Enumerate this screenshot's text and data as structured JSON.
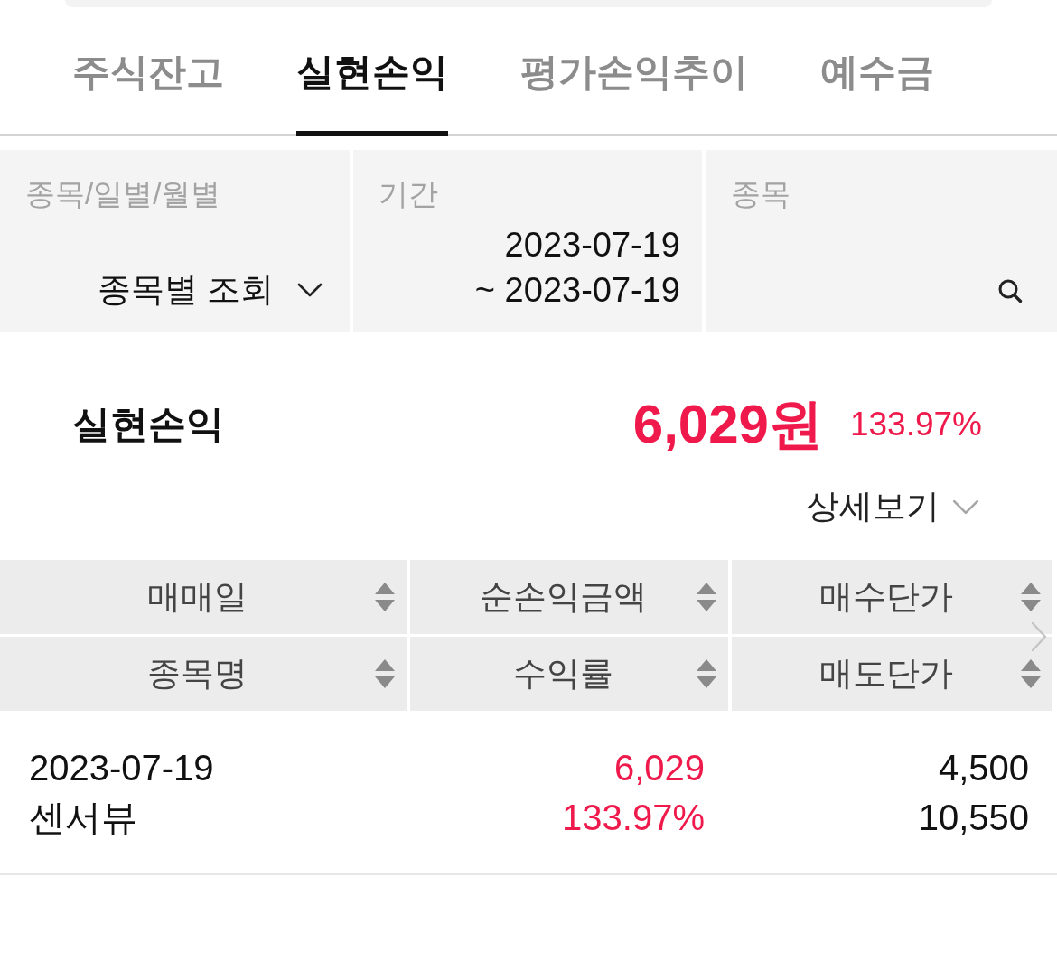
{
  "tabs": [
    {
      "label": "주식잔고",
      "selected": false
    },
    {
      "label": "실현손익",
      "selected": true
    },
    {
      "label": "평가손익추이",
      "selected": false
    },
    {
      "label": "예수금",
      "selected": false
    }
  ],
  "filters": [
    {
      "kind": "select",
      "label": "종목/일별/월별",
      "value": "종목별 조회"
    },
    {
      "kind": "period",
      "label": "기간",
      "lines": [
        "2023-07-19",
        "~ 2023-07-19"
      ]
    },
    {
      "kind": "search",
      "label": "종목"
    }
  ],
  "summary": {
    "label": "실현손익",
    "amount": "6,029원",
    "rate": "133.97%"
  },
  "detail_toggle": {
    "label": "상세보기",
    "expanded": false
  },
  "table": {
    "header_rows": [
      [
        "매매일",
        "순손익금액",
        "매수단가"
      ],
      [
        "종목명",
        "수익률",
        "매도단가"
      ]
    ],
    "rows": [
      {
        "cells": [
          {
            "kind": "plain",
            "lines": [
              "2023-07-19",
              "센서뷰"
            ]
          },
          {
            "kind": "gain",
            "lines": [
              "6,029",
              "133.97%"
            ]
          },
          {
            "kind": "plain",
            "lines": [
              "4,500",
              "10,550"
            ]
          }
        ]
      }
    ]
  }
}
